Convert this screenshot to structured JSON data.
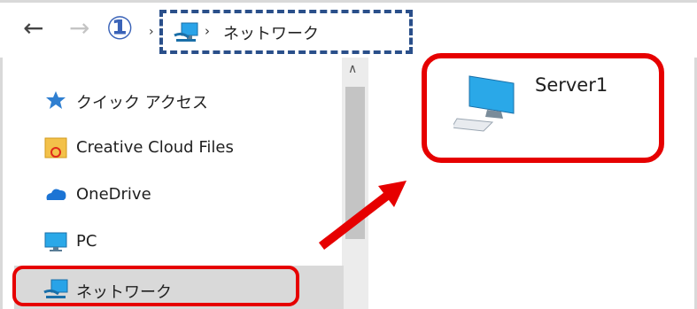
{
  "address_bar": {
    "annotation_number": "①",
    "separator": "›",
    "location": "ネットワーク"
  },
  "nav_pane": {
    "items": [
      {
        "label": "クイック アクセス",
        "icon": "star-pin-icon"
      },
      {
        "label": "Creative Cloud Files",
        "icon": "creative-cloud-folder-icon"
      },
      {
        "label": "OneDrive",
        "icon": "onedrive-cloud-icon"
      },
      {
        "label": "PC",
        "icon": "monitor-icon"
      },
      {
        "label": "ネットワーク",
        "icon": "network-icon"
      }
    ]
  },
  "content": {
    "items": [
      {
        "label": "Server1",
        "icon": "computer-icon"
      }
    ]
  },
  "colors": {
    "highlight_red": "#e60000",
    "dashed_blue": "#2a4f8a",
    "annotation_blue": "#3a63b8",
    "selected_bg": "#d9d9d9"
  }
}
